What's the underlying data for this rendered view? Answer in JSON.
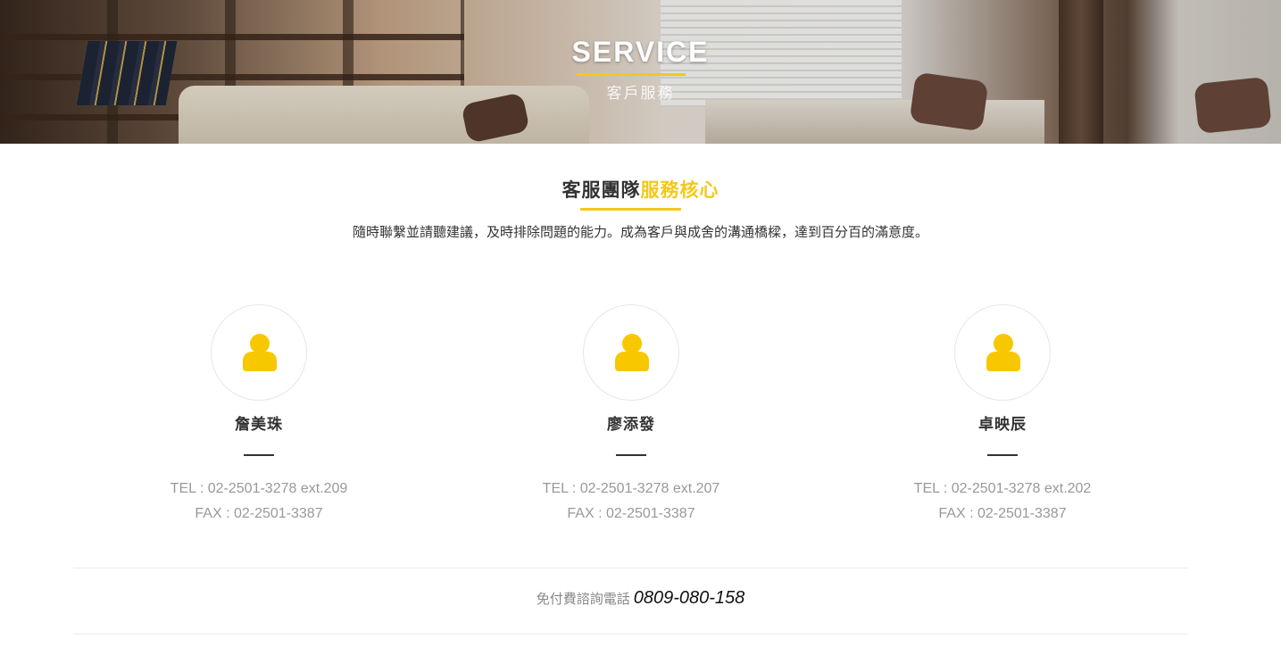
{
  "banner": {
    "title": "SERVICE",
    "subtitle": "客戶服務"
  },
  "section": {
    "title_main": "客服團隊",
    "title_accent": "服務核心",
    "description": "隨時聯繫並請聽建議，及時排除問題的能力。成為客戶與成舍的溝通橋樑，達到百分百的滿意度。"
  },
  "team": [
    {
      "name": "詹美珠",
      "tel": "TEL : 02-2501-3278 ext.209",
      "fax": "FAX : 02-2501-3387"
    },
    {
      "name": "廖添發",
      "tel": "TEL : 02-2501-3278 ext.207",
      "fax": "FAX : 02-2501-3387"
    },
    {
      "name": "卓映辰",
      "tel": "TEL : 02-2501-3278 ext.202",
      "fax": "FAX : 02-2501-3387"
    }
  ],
  "tollfree": {
    "label": "免付費諮詢電話",
    "number": "0809-080-158"
  },
  "colors": {
    "accent": "#f4c81a",
    "icon": "#f7c800",
    "muted_text": "#999999",
    "heading_text": "#333333"
  },
  "icons": {
    "avatar": "user-icon"
  }
}
